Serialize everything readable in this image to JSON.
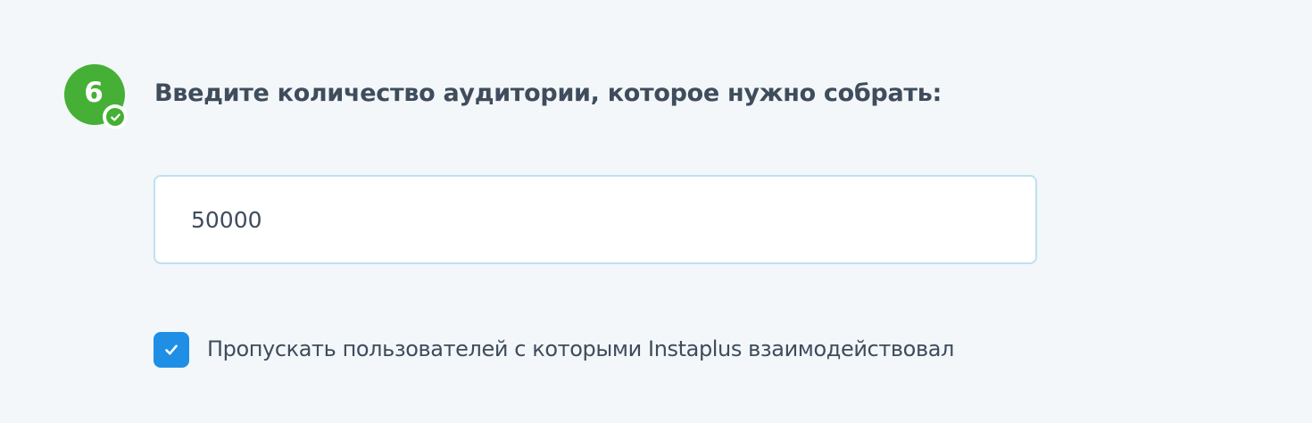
{
  "step": {
    "number": "6",
    "status": "completed",
    "status_icon": "check-icon",
    "badge_color": "#45b035"
  },
  "question": {
    "text": "Введите количество аудитории, которое нужно собрать:"
  },
  "audience_input": {
    "value": "50000"
  },
  "skip_option": {
    "checked": true,
    "label": "Пропускать пользователей с которыми Instaplus взаимодействовал",
    "icon": "checkmark-icon",
    "color": "#1f8fe5"
  }
}
